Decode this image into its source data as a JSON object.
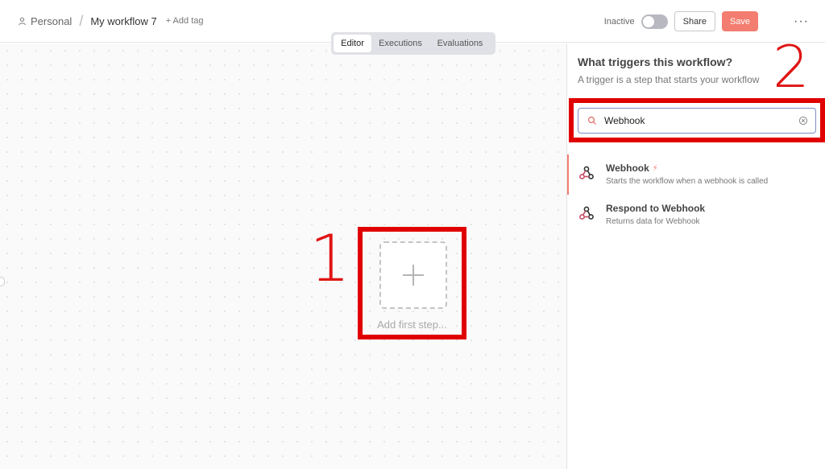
{
  "header": {
    "project": "Personal",
    "separator": "/",
    "workflow_title": "My workflow 7",
    "add_tag": "+ Add tag",
    "status_label": "Inactive",
    "active": false,
    "share_label": "Share",
    "save_label": "Save",
    "more_label": "···"
  },
  "tabs": [
    {
      "label": "Editor",
      "selected": true
    },
    {
      "label": "Executions",
      "selected": false
    },
    {
      "label": "Evaluations",
      "selected": false
    }
  ],
  "canvas": {
    "annotation_number": "1",
    "add_first_step_label": "Add first step...",
    "add_icon": "plus-icon"
  },
  "panel": {
    "title": "What triggers this workflow?",
    "subtitle": "A trigger is a step that starts your workflow",
    "annotation_number": "2",
    "search": {
      "value": "Webhook",
      "icon": "search-icon",
      "clear_icon": "clear-icon"
    },
    "results": [
      {
        "title": "Webhook",
        "description": "Starts the workflow when a webhook is called",
        "icon": "webhook-icon",
        "trigger_badge": "bolt-icon",
        "active": true
      },
      {
        "title": "Respond to Webhook",
        "description": "Returns data for Webhook",
        "icon": "webhook-icon",
        "active": false
      }
    ]
  },
  "colors": {
    "accent": "#f37d70",
    "annotation_red": "#e00000",
    "search_border": "#7f8cc4"
  }
}
